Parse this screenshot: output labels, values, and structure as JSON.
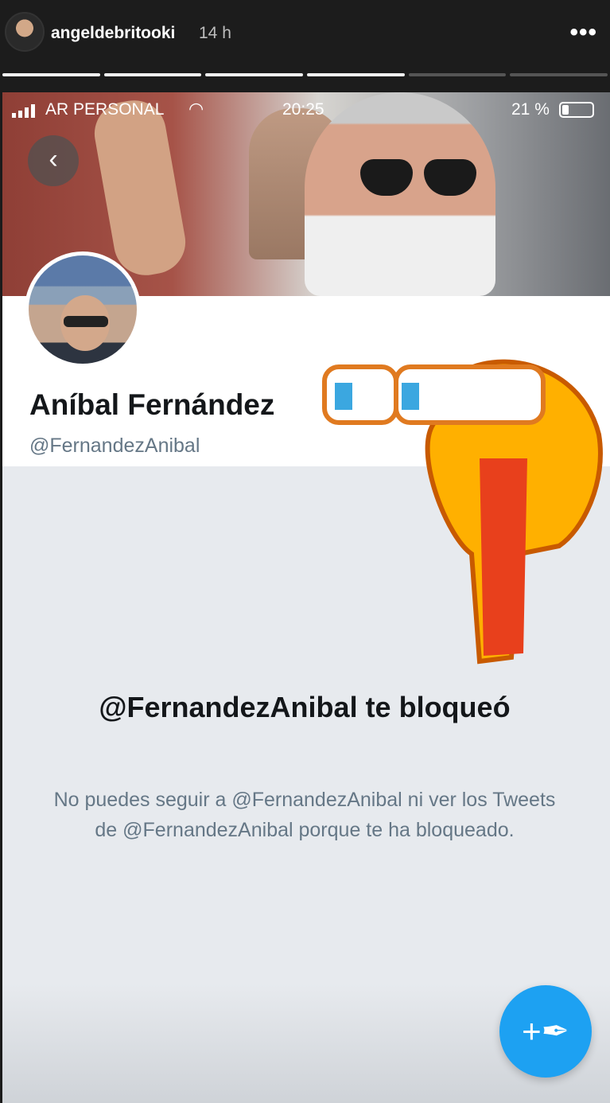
{
  "story": {
    "username": "angeldebritooki",
    "time": "14 h",
    "more_icon": "more-horizontal-icon",
    "segments": [
      true,
      true,
      true,
      true,
      false,
      false
    ]
  },
  "status_bar": {
    "carrier": "AR PERSONAL",
    "time": "20:25",
    "battery": "21 %"
  },
  "profile": {
    "name": "Aníbal Fernández",
    "handle": "@FernandezAnibal",
    "verified_mark": "✓"
  },
  "blocked": {
    "title": "@FernandezAnibal te bloqueó",
    "message": "No puedes seguir a @FernandezAnibal ni ver los Tweets de @FernandezAnibal porque te ha bloqueado."
  },
  "colors": {
    "twitter_blue": "#1da1f2",
    "background": "#e7eaee",
    "text_dark": "#14171a",
    "text_muted": "#657786"
  }
}
